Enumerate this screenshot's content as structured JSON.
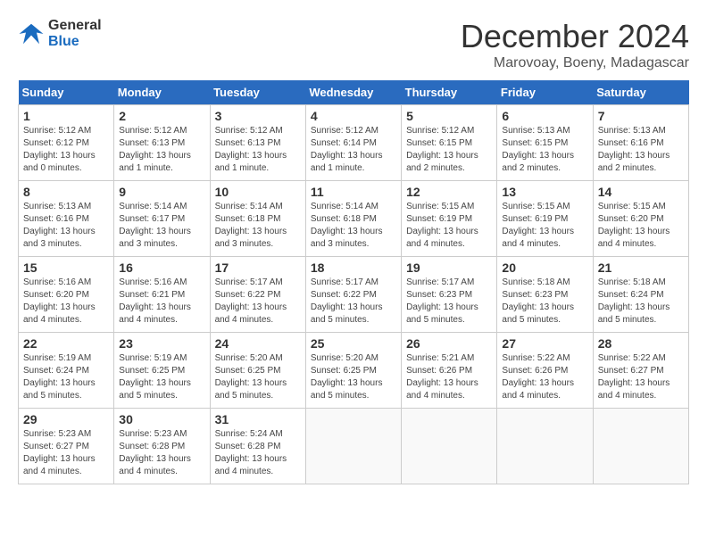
{
  "header": {
    "logo_line1": "General",
    "logo_line2": "Blue",
    "month_title": "December 2024",
    "location": "Marovoay, Boeny, Madagascar"
  },
  "weekdays": [
    "Sunday",
    "Monday",
    "Tuesday",
    "Wednesday",
    "Thursday",
    "Friday",
    "Saturday"
  ],
  "weeks": [
    [
      {
        "day": "1",
        "info": "Sunrise: 5:12 AM\nSunset: 6:12 PM\nDaylight: 13 hours\nand 0 minutes."
      },
      {
        "day": "2",
        "info": "Sunrise: 5:12 AM\nSunset: 6:13 PM\nDaylight: 13 hours\nand 1 minute."
      },
      {
        "day": "3",
        "info": "Sunrise: 5:12 AM\nSunset: 6:13 PM\nDaylight: 13 hours\nand 1 minute."
      },
      {
        "day": "4",
        "info": "Sunrise: 5:12 AM\nSunset: 6:14 PM\nDaylight: 13 hours\nand 1 minute."
      },
      {
        "day": "5",
        "info": "Sunrise: 5:12 AM\nSunset: 6:15 PM\nDaylight: 13 hours\nand 2 minutes."
      },
      {
        "day": "6",
        "info": "Sunrise: 5:13 AM\nSunset: 6:15 PM\nDaylight: 13 hours\nand 2 minutes."
      },
      {
        "day": "7",
        "info": "Sunrise: 5:13 AM\nSunset: 6:16 PM\nDaylight: 13 hours\nand 2 minutes."
      }
    ],
    [
      {
        "day": "8",
        "info": "Sunrise: 5:13 AM\nSunset: 6:16 PM\nDaylight: 13 hours\nand 3 minutes."
      },
      {
        "day": "9",
        "info": "Sunrise: 5:14 AM\nSunset: 6:17 PM\nDaylight: 13 hours\nand 3 minutes."
      },
      {
        "day": "10",
        "info": "Sunrise: 5:14 AM\nSunset: 6:18 PM\nDaylight: 13 hours\nand 3 minutes."
      },
      {
        "day": "11",
        "info": "Sunrise: 5:14 AM\nSunset: 6:18 PM\nDaylight: 13 hours\nand 3 minutes."
      },
      {
        "day": "12",
        "info": "Sunrise: 5:15 AM\nSunset: 6:19 PM\nDaylight: 13 hours\nand 4 minutes."
      },
      {
        "day": "13",
        "info": "Sunrise: 5:15 AM\nSunset: 6:19 PM\nDaylight: 13 hours\nand 4 minutes."
      },
      {
        "day": "14",
        "info": "Sunrise: 5:15 AM\nSunset: 6:20 PM\nDaylight: 13 hours\nand 4 minutes."
      }
    ],
    [
      {
        "day": "15",
        "info": "Sunrise: 5:16 AM\nSunset: 6:20 PM\nDaylight: 13 hours\nand 4 minutes."
      },
      {
        "day": "16",
        "info": "Sunrise: 5:16 AM\nSunset: 6:21 PM\nDaylight: 13 hours\nand 4 minutes."
      },
      {
        "day": "17",
        "info": "Sunrise: 5:17 AM\nSunset: 6:22 PM\nDaylight: 13 hours\nand 4 minutes."
      },
      {
        "day": "18",
        "info": "Sunrise: 5:17 AM\nSunset: 6:22 PM\nDaylight: 13 hours\nand 5 minutes."
      },
      {
        "day": "19",
        "info": "Sunrise: 5:17 AM\nSunset: 6:23 PM\nDaylight: 13 hours\nand 5 minutes."
      },
      {
        "day": "20",
        "info": "Sunrise: 5:18 AM\nSunset: 6:23 PM\nDaylight: 13 hours\nand 5 minutes."
      },
      {
        "day": "21",
        "info": "Sunrise: 5:18 AM\nSunset: 6:24 PM\nDaylight: 13 hours\nand 5 minutes."
      }
    ],
    [
      {
        "day": "22",
        "info": "Sunrise: 5:19 AM\nSunset: 6:24 PM\nDaylight: 13 hours\nand 5 minutes."
      },
      {
        "day": "23",
        "info": "Sunrise: 5:19 AM\nSunset: 6:25 PM\nDaylight: 13 hours\nand 5 minutes."
      },
      {
        "day": "24",
        "info": "Sunrise: 5:20 AM\nSunset: 6:25 PM\nDaylight: 13 hours\nand 5 minutes."
      },
      {
        "day": "25",
        "info": "Sunrise: 5:20 AM\nSunset: 6:25 PM\nDaylight: 13 hours\nand 5 minutes."
      },
      {
        "day": "26",
        "info": "Sunrise: 5:21 AM\nSunset: 6:26 PM\nDaylight: 13 hours\nand 4 minutes."
      },
      {
        "day": "27",
        "info": "Sunrise: 5:22 AM\nSunset: 6:26 PM\nDaylight: 13 hours\nand 4 minutes."
      },
      {
        "day": "28",
        "info": "Sunrise: 5:22 AM\nSunset: 6:27 PM\nDaylight: 13 hours\nand 4 minutes."
      }
    ],
    [
      {
        "day": "29",
        "info": "Sunrise: 5:23 AM\nSunset: 6:27 PM\nDaylight: 13 hours\nand 4 minutes."
      },
      {
        "day": "30",
        "info": "Sunrise: 5:23 AM\nSunset: 6:28 PM\nDaylight: 13 hours\nand 4 minutes."
      },
      {
        "day": "31",
        "info": "Sunrise: 5:24 AM\nSunset: 6:28 PM\nDaylight: 13 hours\nand 4 minutes."
      },
      null,
      null,
      null,
      null
    ]
  ]
}
